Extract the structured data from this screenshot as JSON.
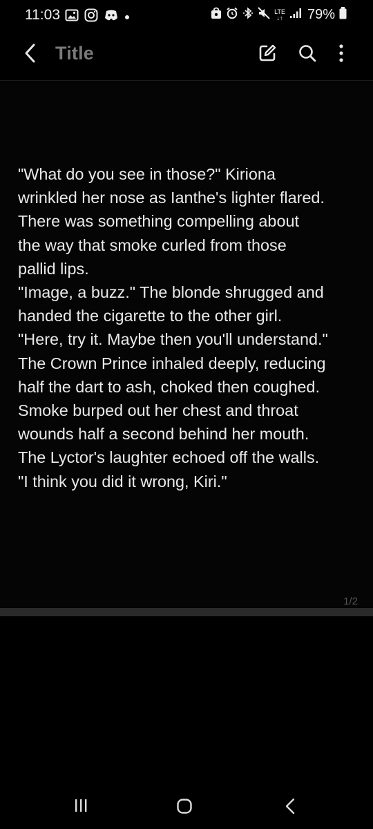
{
  "status_bar": {
    "time": "11:03",
    "battery_percent": "79%",
    "network_label": "LTE",
    "left_icons": [
      "gallery-icon",
      "instagram-icon",
      "discord-icon",
      "dot-icon"
    ],
    "right_icons": [
      "bag-icon",
      "alarm-icon",
      "bluetooth-icon",
      "mute-icon",
      "lte-icon",
      "signal-icon",
      "battery-icon"
    ]
  },
  "app_bar": {
    "title": "Title",
    "actions": [
      "edit-icon",
      "search-icon",
      "more-icon"
    ]
  },
  "note": {
    "lines": [
      "\"What do you see in those?\" Kiriona",
      "wrinkled her nose as Ianthe's lighter flared.",
      "There was something compelling about",
      "the way that smoke curled from those",
      "pallid lips.",
      "\"Image, a buzz.\" The blonde shrugged and",
      "handed the cigarette to the other girl.",
      "\"Here, try it. Maybe then you'll understand.\"",
      "The Crown Prince inhaled deeply, reducing",
      "half the dart to ash, choked then coughed.",
      "Smoke burped out her chest and throat",
      "wounds half a second behind her mouth.",
      "The Lyctor's laughter echoed off the walls.",
      "\"I think you did it wrong, Kiri.\""
    ],
    "page_indicator": "1/2"
  },
  "colors": {
    "background": "#000000",
    "text": "#e9e9e9",
    "title": "#7a7a7a",
    "divider": "#2a2a2a"
  },
  "nav_bar": {
    "buttons": [
      "recent-apps-icon",
      "home-icon",
      "back-icon"
    ]
  }
}
